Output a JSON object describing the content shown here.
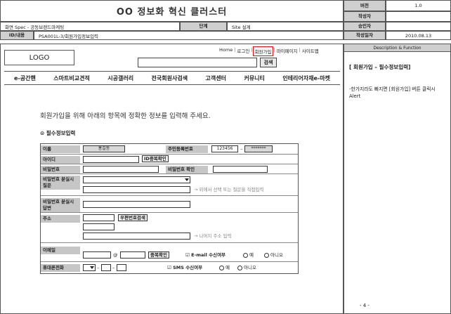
{
  "doc": {
    "title": "OO 정보화 혁신 클러스터",
    "screen_label": "화면 Spec - 공동브랜드마케팅",
    "id_label": "ID/내용",
    "id_value": "PSA001L-3/회원가입정보입력",
    "stage_label": "단계",
    "stage_value": "Site 설계",
    "version_label": "버전",
    "version_value": "1.0",
    "author_label": "작성자",
    "author_value": "",
    "approver_label": "승인자",
    "approver_value": "",
    "date_label": "작성일자",
    "date_value": "2010.08.13"
  },
  "site": {
    "logo": "LOGO",
    "top_links": [
      "Home",
      "로그인",
      "회원가입",
      "마이페이지",
      "사이트맵"
    ],
    "search_button": "검색",
    "nav": [
      "e-공간핸",
      "스마트비교견적",
      "시공갤러리",
      "전국회원사검색",
      "고객센터",
      "커뮤니티",
      "인테리어자재e-마켓"
    ]
  },
  "form": {
    "intro": "회원가입을 위해 아래의 항목에 정확한 정보를 입력해 주세요.",
    "section_title": "필수정보입력",
    "name_label": "이름",
    "name_value": "홍길동",
    "jumin_label": "주민등록번호",
    "jumin_front": "123456",
    "jumin_dash": "–",
    "jumin_back": "*******",
    "id_label": "아이디",
    "id_check_button": "ID중복확인",
    "pw_label": "비밀번호",
    "pw_confirm_label": "비밀번호 확인",
    "pw_question_label": "비밀번호 분실시 질문",
    "pw_question_hint": "→ 위에서 선택 또는 질문을 직접입력",
    "pw_answer_label": "비밀번호 분실시 답변",
    "address_label": "주소",
    "zip_dash": "–",
    "zip_search_button": "우편번호검색",
    "address_hint": "→ 나머지 주소 입력",
    "email_label": "이메일",
    "email_at": "@",
    "email_check_button": "중복확인",
    "email_subscribe_label": "E-mail 수신여부",
    "sms_subscribe_label": "SMS 수신여부",
    "yes": "예",
    "no": "아니오",
    "phone_label": "휴대폰전화",
    "phone_dash": "–"
  },
  "side": {
    "header": "Description & Function",
    "title": "[ 회원가입 – 필수정보입력]",
    "description": "-한가지라도 빠지면 [회원가입] 버튼 클릭시 Alert",
    "page": "- 4 -"
  }
}
